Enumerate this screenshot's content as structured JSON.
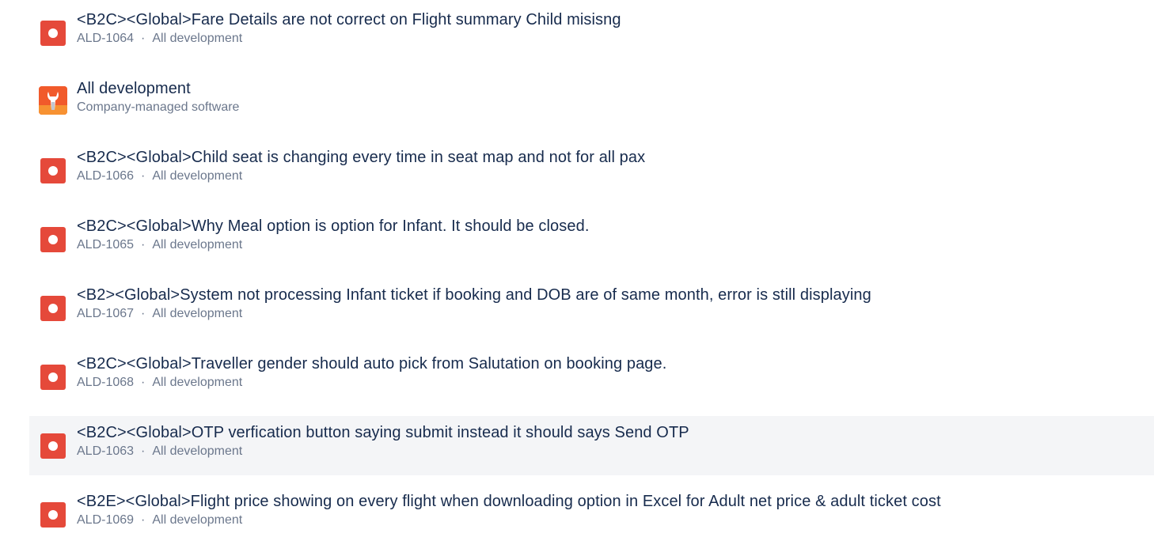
{
  "results": [
    {
      "type": "bug",
      "title": "<B2C><Global>Fare Details are not correct on Flight summary Child misisng",
      "key": "ALD-1064",
      "project": "All development"
    },
    {
      "type": "project",
      "title": "All development",
      "subtitle": "Company-managed software"
    },
    {
      "type": "bug",
      "title": "<B2C><Global>Child seat is changing every time in seat map and not for all pax",
      "key": "ALD-1066",
      "project": "All development"
    },
    {
      "type": "bug",
      "title": "<B2C><Global>Why Meal option is option for Infant. It should be closed.",
      "key": "ALD-1065",
      "project": "All development"
    },
    {
      "type": "bug",
      "title": "<B2><Global>System not processing Infant ticket if booking and DOB are of same month, error is still displaying",
      "key": "ALD-1067",
      "project": "All development"
    },
    {
      "type": "bug",
      "title": "<B2C><Global>Traveller gender should auto pick from Salutation on booking page.",
      "key": "ALD-1068",
      "project": "All development"
    },
    {
      "type": "bug",
      "title": "<B2C><Global>OTP verfication button saying submit instead it should says Send OTP",
      "key": "ALD-1063",
      "project": "All development"
    },
    {
      "type": "bug",
      "title": "<B2E><Global>Flight price showing on every flight when downloading option in Excel for Adult net price & adult ticket cost",
      "key": "ALD-1069",
      "project": "All development"
    }
  ],
  "separator": "·",
  "colors": {
    "bug_icon": "#e5493a",
    "project_icon": "#f15a2b",
    "title_text": "#172b4d",
    "meta_text": "#6b778c",
    "hover_row": "#f4f5f7"
  },
  "icons": {
    "bug": "bug-icon",
    "project": "wrench-icon"
  }
}
